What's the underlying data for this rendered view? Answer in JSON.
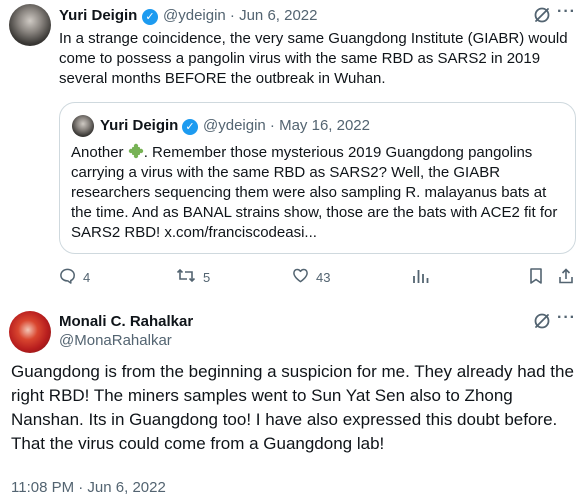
{
  "tweet": {
    "author_name": "Yuri Deigin",
    "handle_date": "@ydeigin · Jun 6, 2022",
    "text": "In a strange coincidence, the very same Guangdong Institute (GIABR) would come to possess a pangolin virus with the same RBD as SARS2 in 2019 several months BEFORE the outbreak in Wuhan."
  },
  "quote": {
    "author_name": "Yuri Deigin",
    "handle_date": "@ydeigin · May 16, 2022",
    "text_before_emoji": "Another ",
    "text_after_emoji": ". Remember those mysterious 2019 Guangdong pangolins carrying a virus with the same RBD as SARS2? Well, the GIABR researchers sequencing them were also sampling R. malayanus bats at the time. And as BANAL strains show, those are the bats with ACE2 fit for SARS2 RBD! x.com/franciscodeasi..."
  },
  "actions": {
    "replies": "4",
    "retweets": "5",
    "likes": "43"
  },
  "reply": {
    "author_name": "Monali C. Rahalkar",
    "handle": "@MonaRahalkar",
    "text": "Guangdong is from the beginning a suspicion for me. They already had the right RBD! The miners samples went to Sun Yat Sen also to Zhong Nanshan. Its in Guangdong too! I have also expressed this doubt before. That the virus could come from a Guangdong lab!",
    "timestamp": "11:08 PM · Jun 6, 2022"
  },
  "colors": {
    "verified": "#1d9bf0",
    "muted_text": "#536471",
    "border": "#cfd9de"
  },
  "icons": [
    "verified-badge-icon",
    "grok-slash-icon",
    "more-icon",
    "puzzle-emoji-icon",
    "reply-icon",
    "retweet-icon",
    "like-icon",
    "view-stats-icon",
    "bookmark-icon",
    "share-icon"
  ]
}
